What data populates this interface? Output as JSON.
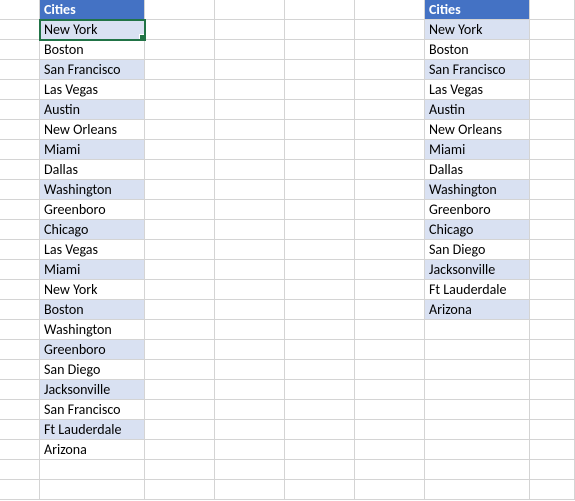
{
  "leftHeader": "Cities",
  "rightHeader": "Cities",
  "leftList": [
    "New York",
    "Boston",
    "San Francisco",
    "Las Vegas",
    "Austin",
    "New Orleans",
    "Miami",
    "Dallas",
    "Washington",
    "Greenboro",
    "Chicago",
    "Las Vegas",
    "Miami",
    "New York",
    "Boston",
    "Washington",
    "Greenboro",
    "San Diego",
    "Jacksonville",
    "San Francisco",
    "Ft Lauderdale",
    "Arizona"
  ],
  "rightList": [
    "New York",
    "Boston",
    "San Francisco",
    "Las Vegas",
    "Austin",
    "New Orleans",
    "Miami",
    "Dallas",
    "Washington",
    "Greenboro",
    "Chicago",
    "San Diego",
    "Jacksonville",
    "Ft Lauderdale",
    "Arizona"
  ],
  "selectedCell": {
    "col": 1,
    "row": 1
  },
  "totalRows": 25
}
